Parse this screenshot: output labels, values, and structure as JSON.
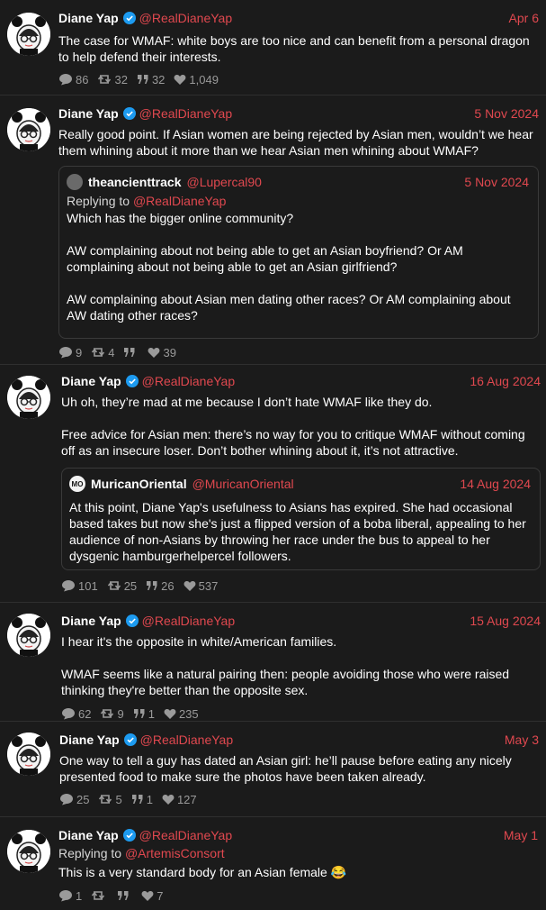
{
  "colors": {
    "accent": "#e0484f",
    "background": "#1b1b1b",
    "verified": "#1d9bf0"
  },
  "tweets": [
    {
      "name": "Diane Yap",
      "handle": "@RealDianeYap",
      "date": "Apr 6",
      "text": "The case for WMAF: white boys are too nice and can benefit from a personal dragon to help defend their interests.",
      "stats": {
        "replies": "86",
        "retweets": "32",
        "quotes": "32",
        "likes": "1,049"
      }
    },
    {
      "name": "Diane Yap",
      "handle": "@RealDianeYap",
      "date": "5 Nov 2024",
      "text": "Really good point. If Asian women are being rejected by Asian men, wouldn’t we hear them whining about it more than we hear Asian men whining about WMAF?",
      "quote": {
        "name": "theancienttrack",
        "handle": "@Lupercal90",
        "date": "5 Nov 2024",
        "replying_label": "Replying to",
        "replying_handle": "@RealDianeYap",
        "text": "Which has the bigger online community?\n\nAW complaining about not being able to get an Asian boyfriend? Or AM complaining about not being able to get an Asian girlfriend?\n\nAW complaining about Asian men dating other races? Or AM complaining about AW dating other races?"
      },
      "stats": {
        "replies": "9",
        "retweets": "4",
        "quotes": "",
        "likes": "39"
      }
    },
    {
      "name": "Diane Yap",
      "handle": "@RealDianeYap",
      "date": "16 Aug 2024",
      "text": "Uh oh, they’re mad at me because I don’t hate WMAF like they do.\n\nFree advice for Asian men: there’s no way for you to critique WMAF without coming off as an insecure loser. Don’t bother whining about it, it’s not attractive.",
      "quote": {
        "name": "MuricanOriental",
        "handle": "@MuricanOriental",
        "date": "14 Aug 2024",
        "avatar_text": "MO",
        "text": "At this point, Diane Yap's usefulness to Asians has expired. She had occasional based takes but now she's just a flipped version of a boba liberal, appealing to her audience of non-Asians by throwing her race under the bus to appeal to her dysgenic hamburgerhelpercel followers."
      },
      "stats": {
        "replies": "101",
        "retweets": "25",
        "quotes": "26",
        "likes": "537"
      }
    },
    {
      "name": "Diane Yap",
      "handle": "@RealDianeYap",
      "date": "15 Aug 2024",
      "text": "I hear it's the opposite in white/American families.\n\nWMAF seems like a natural pairing then: people avoiding those who were raised thinking they're better than the opposite sex.",
      "stats": {
        "replies": "62",
        "retweets": "9",
        "quotes": "1",
        "likes": "235"
      }
    },
    {
      "name": "Diane Yap",
      "handle": "@RealDianeYap",
      "date": "May 3",
      "text": "One way to tell a guy has dated an Asian girl: he’ll pause before eating any nicely presented food to make sure the photos have been taken already.",
      "stats": {
        "replies": "25",
        "retweets": "5",
        "quotes": "1",
        "likes": "127"
      }
    },
    {
      "name": "Diane Yap",
      "handle": "@RealDianeYap",
      "date": "May 1",
      "replying_label": "Replying to",
      "replying_handle": "@ArtemisConsort",
      "text": "This is a very standard body for an Asian female 😂",
      "stats": {
        "replies": "1",
        "retweets": "",
        "quotes": "",
        "likes": "7"
      }
    }
  ]
}
